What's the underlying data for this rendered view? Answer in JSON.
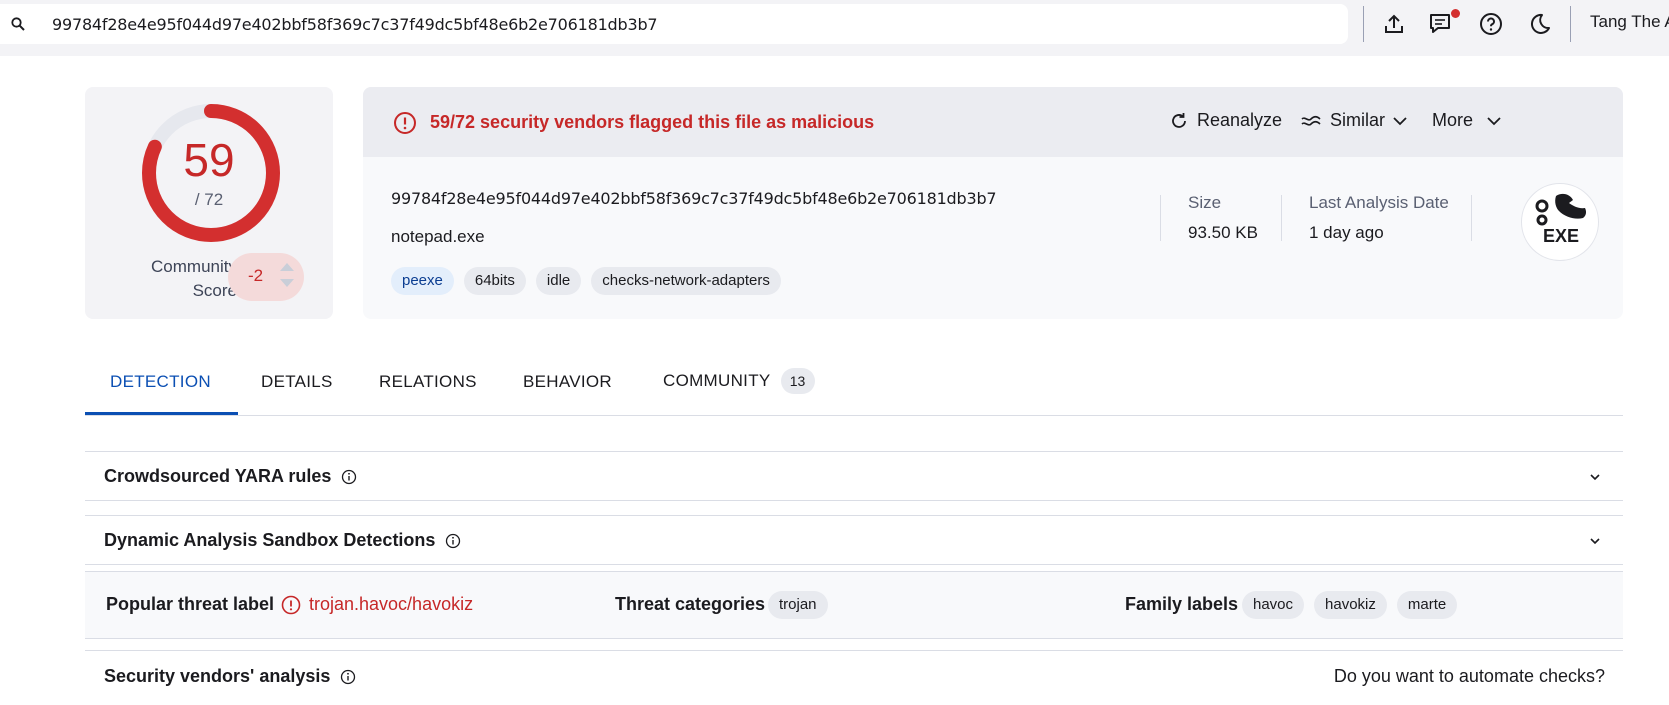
{
  "topbar": {
    "search_value": "99784f28e4e95f044d97e402bbf58f369c7c37f49dc5bf48e6b2e706181db3b7",
    "icons": [
      "search-icon",
      "upload-icon",
      "chat-icon",
      "help-icon",
      "dark-mode-icon"
    ],
    "user_name": "Tang The A"
  },
  "score": {
    "detections": "59",
    "total": "/ 72",
    "detection_ratio": 0.8194,
    "community_label": "Community Score",
    "community_value": "-2"
  },
  "alert": {
    "text": "59/72 security vendors flagged this file as malicious",
    "reanalyze": "Reanalyze",
    "similar": "Similar",
    "more": "More"
  },
  "file": {
    "hash": "99784f28e4e95f044d97e402bbf58f369c7c37f49dc5bf48e6b2e706181db3b7",
    "name": "notepad.exe",
    "tags": [
      "peexe",
      "64bits",
      "idle",
      "checks-network-adapters"
    ],
    "size_label": "Size",
    "size_value": "93.50 KB",
    "date_label": "Last Analysis Date",
    "date_value": "1 day ago",
    "type_icon_text": "EXE"
  },
  "tabs": {
    "detection": "DETECTION",
    "details": "DETAILS",
    "relations": "RELATIONS",
    "behavior": "BEHAVIOR",
    "community": "COMMUNITY",
    "community_count": "13"
  },
  "sections": {
    "yara": "Crowdsourced YARA rules",
    "sandbox": "Dynamic Analysis Sandbox Detections",
    "vendors": "Security vendors' analysis",
    "automate": "Do you want to automate checks?"
  },
  "threat": {
    "popular_label": "Popular threat label",
    "popular_value": "trojan.havoc/havokiz",
    "categories_label": "Threat categories",
    "categories": [
      "trojan"
    ],
    "family_label": "Family labels",
    "families": [
      "havoc",
      "havokiz",
      "marte"
    ]
  },
  "colors": {
    "malicious": "#c62828",
    "accent": "#0b4fb3",
    "background_panel": "#f3f3f6"
  }
}
